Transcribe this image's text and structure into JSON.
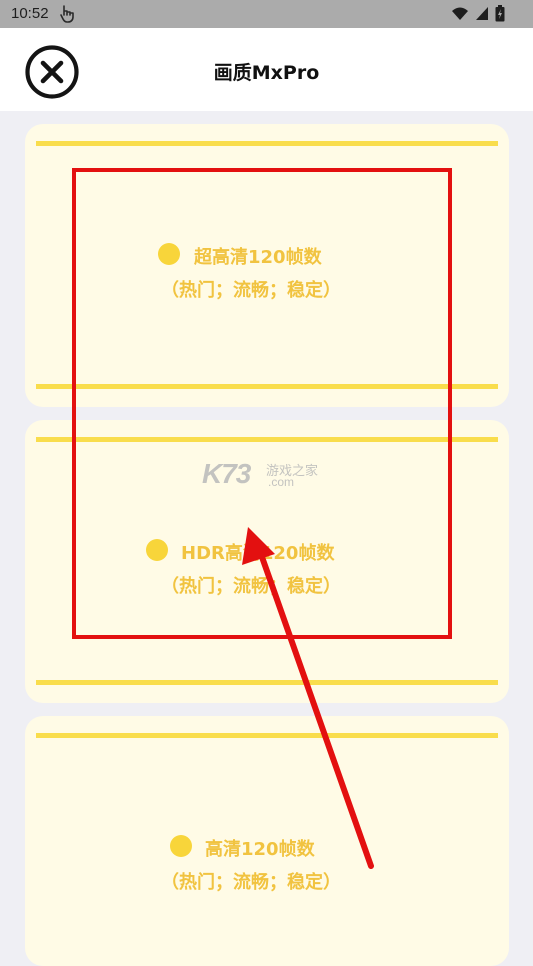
{
  "status_bar": {
    "time": "10:52"
  },
  "header": {
    "title": "画质MxPro"
  },
  "cards": [
    {
      "title": "超高清120帧数",
      "subtitle": "（热门；流畅；稳定）"
    },
    {
      "title": "HDR高清120帧数",
      "subtitle": "（热门；流畅；稳定）"
    },
    {
      "title": "高清120帧数",
      "subtitle": "（热门；流畅；稳定）"
    }
  ],
  "watermark": {
    "main": "K73",
    "small": "游戏之家",
    "domain": ".com"
  },
  "colors": {
    "card_bg": "#fffbe6",
    "accent_yellow": "#f9dd4c",
    "label_yellow": "#f1c340",
    "annotation_red": "#e31010"
  }
}
